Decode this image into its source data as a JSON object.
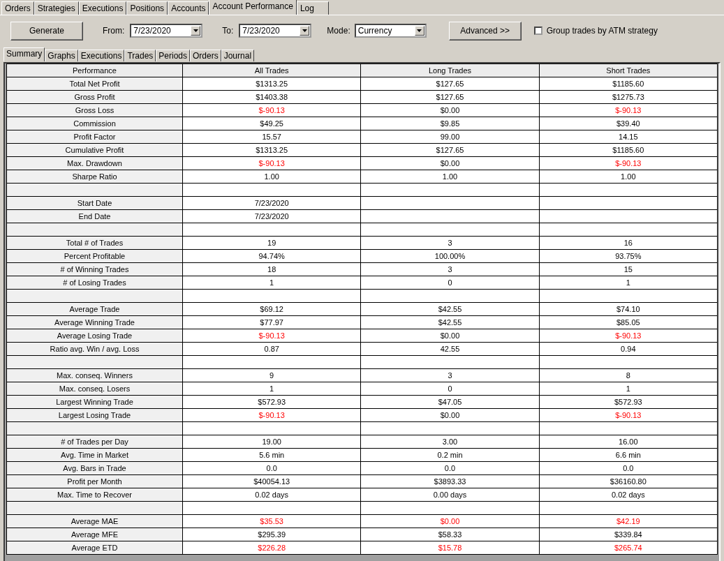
{
  "main_tabs": [
    {
      "label": "Orders",
      "selected": false
    },
    {
      "label": "Strategies",
      "selected": false
    },
    {
      "label": "Executions",
      "selected": false
    },
    {
      "label": "Positions",
      "selected": false
    },
    {
      "label": "Accounts",
      "selected": false
    },
    {
      "label": "Account Performance",
      "selected": true
    },
    {
      "label": "Log",
      "selected": false
    }
  ],
  "toolbar": {
    "generate": "Generate",
    "from_label": "From:",
    "from_value": "7/23/2020",
    "to_label": "To:",
    "to_value": "7/23/2020",
    "mode_label": "Mode:",
    "mode_value": "Currency",
    "advanced": "Advanced >>",
    "group_checkbox": {
      "label": "Group trades by ATM strategy",
      "checked": false
    }
  },
  "sub_tabs": [
    {
      "label": "Summary",
      "selected": true
    },
    {
      "label": "Graphs",
      "selected": false
    },
    {
      "label": "Executions",
      "selected": false
    },
    {
      "label": "Trades",
      "selected": false
    },
    {
      "label": "Periods",
      "selected": false
    },
    {
      "label": "Orders",
      "selected": false
    },
    {
      "label": "Journal",
      "selected": false
    }
  ],
  "table": {
    "columns": [
      "Performance",
      "All Trades",
      "Long Trades",
      "Short Trades"
    ],
    "rows": [
      {
        "kind": "data",
        "label": "Total Net Profit",
        "cells": [
          {
            "text": "$1313.25",
            "negative": false
          },
          {
            "text": "$127.65",
            "negative": false
          },
          {
            "text": "$1185.60",
            "negative": false
          }
        ]
      },
      {
        "kind": "data",
        "label": "Gross Profit",
        "cells": [
          {
            "text": "$1403.38",
            "negative": false
          },
          {
            "text": "$127.65",
            "negative": false
          },
          {
            "text": "$1275.73",
            "negative": false
          }
        ]
      },
      {
        "kind": "data",
        "label": "Gross Loss",
        "cells": [
          {
            "text": "$-90.13",
            "negative": true
          },
          {
            "text": "$0.00",
            "negative": false
          },
          {
            "text": "$-90.13",
            "negative": true
          }
        ]
      },
      {
        "kind": "data",
        "label": "Commission",
        "cells": [
          {
            "text": "$49.25",
            "negative": false
          },
          {
            "text": "$9.85",
            "negative": false
          },
          {
            "text": "$39.40",
            "negative": false
          }
        ]
      },
      {
        "kind": "data",
        "label": "Profit Factor",
        "cells": [
          {
            "text": "15.57",
            "negative": false
          },
          {
            "text": "99.00",
            "negative": false
          },
          {
            "text": "14.15",
            "negative": false
          }
        ]
      },
      {
        "kind": "data",
        "label": "Cumulative Profit",
        "cells": [
          {
            "text": "$1313.25",
            "negative": false
          },
          {
            "text": "$127.65",
            "negative": false
          },
          {
            "text": "$1185.60",
            "negative": false
          }
        ]
      },
      {
        "kind": "data",
        "label": "Max. Drawdown",
        "cells": [
          {
            "text": "$-90.13",
            "negative": true
          },
          {
            "text": "$0.00",
            "negative": false
          },
          {
            "text": "$-90.13",
            "negative": true
          }
        ]
      },
      {
        "kind": "data",
        "label": "Sharpe Ratio",
        "cells": [
          {
            "text": "1.00",
            "negative": false
          },
          {
            "text": "1.00",
            "negative": false
          },
          {
            "text": "1.00",
            "negative": false
          }
        ]
      },
      {
        "kind": "blank"
      },
      {
        "kind": "data",
        "label": "Start Date",
        "cells": [
          {
            "text": "7/23/2020",
            "negative": false
          }
        ]
      },
      {
        "kind": "data",
        "label": "End Date",
        "cells": [
          {
            "text": "7/23/2020",
            "negative": false
          }
        ]
      },
      {
        "kind": "blank"
      },
      {
        "kind": "data",
        "label": "Total # of Trades",
        "cells": [
          {
            "text": "19",
            "negative": false
          },
          {
            "text": "3",
            "negative": false
          },
          {
            "text": "16",
            "negative": false
          }
        ]
      },
      {
        "kind": "data",
        "label": "Percent Profitable",
        "cells": [
          {
            "text": "94.74%",
            "negative": false
          },
          {
            "text": "100.00%",
            "negative": false
          },
          {
            "text": "93.75%",
            "negative": false
          }
        ]
      },
      {
        "kind": "data",
        "label": "# of Winning Trades",
        "cells": [
          {
            "text": "18",
            "negative": false
          },
          {
            "text": "3",
            "negative": false
          },
          {
            "text": "15",
            "negative": false
          }
        ]
      },
      {
        "kind": "data",
        "label": "# of Losing Trades",
        "cells": [
          {
            "text": "1",
            "negative": false
          },
          {
            "text": "0",
            "negative": false
          },
          {
            "text": "1",
            "negative": false
          }
        ]
      },
      {
        "kind": "blank"
      },
      {
        "kind": "data",
        "label": "Average Trade",
        "cells": [
          {
            "text": "$69.12",
            "negative": false
          },
          {
            "text": "$42.55",
            "negative": false
          },
          {
            "text": "$74.10",
            "negative": false
          }
        ]
      },
      {
        "kind": "data",
        "label": "Average Winning Trade",
        "cells": [
          {
            "text": "$77.97",
            "negative": false
          },
          {
            "text": "$42.55",
            "negative": false
          },
          {
            "text": "$85.05",
            "negative": false
          }
        ]
      },
      {
        "kind": "data",
        "label": "Average Losing Trade",
        "cells": [
          {
            "text": "$-90.13",
            "negative": true
          },
          {
            "text": "$0.00",
            "negative": false
          },
          {
            "text": "$-90.13",
            "negative": true
          }
        ]
      },
      {
        "kind": "data",
        "label": "Ratio avg. Win / avg. Loss",
        "cells": [
          {
            "text": "0.87",
            "negative": false
          },
          {
            "text": "42.55",
            "negative": false
          },
          {
            "text": "0.94",
            "negative": false
          }
        ]
      },
      {
        "kind": "blank"
      },
      {
        "kind": "data",
        "label": "Max. conseq. Winners",
        "cells": [
          {
            "text": "9",
            "negative": false
          },
          {
            "text": "3",
            "negative": false
          },
          {
            "text": "8",
            "negative": false
          }
        ]
      },
      {
        "kind": "data",
        "label": "Max. conseq. Losers",
        "cells": [
          {
            "text": "1",
            "negative": false
          },
          {
            "text": "0",
            "negative": false
          },
          {
            "text": "1",
            "negative": false
          }
        ]
      },
      {
        "kind": "data",
        "label": "Largest Winning Trade",
        "cells": [
          {
            "text": "$572.93",
            "negative": false
          },
          {
            "text": "$47.05",
            "negative": false
          },
          {
            "text": "$572.93",
            "negative": false
          }
        ]
      },
      {
        "kind": "data",
        "label": "Largest Losing Trade",
        "cells": [
          {
            "text": "$-90.13",
            "negative": true
          },
          {
            "text": "$0.00",
            "negative": false
          },
          {
            "text": "$-90.13",
            "negative": true
          }
        ]
      },
      {
        "kind": "blank"
      },
      {
        "kind": "data",
        "label": "# of Trades per Day",
        "cells": [
          {
            "text": "19.00",
            "negative": false
          },
          {
            "text": "3.00",
            "negative": false
          },
          {
            "text": "16.00",
            "negative": false
          }
        ]
      },
      {
        "kind": "data",
        "label": "Avg. Time in Market",
        "cells": [
          {
            "text": "5.6 min",
            "negative": false
          },
          {
            "text": "0.2 min",
            "negative": false
          },
          {
            "text": "6.6 min",
            "negative": false
          }
        ]
      },
      {
        "kind": "data",
        "label": "Avg. Bars in Trade",
        "cells": [
          {
            "text": "0.0",
            "negative": false
          },
          {
            "text": "0.0",
            "negative": false
          },
          {
            "text": "0.0",
            "negative": false
          }
        ]
      },
      {
        "kind": "data",
        "label": "Profit per Month",
        "cells": [
          {
            "text": "$40054.13",
            "negative": false
          },
          {
            "text": "$3893.33",
            "negative": false
          },
          {
            "text": "$36160.80",
            "negative": false
          }
        ]
      },
      {
        "kind": "data",
        "label": "Max. Time to Recover",
        "cells": [
          {
            "text": "0.02 days",
            "negative": false
          },
          {
            "text": "0.00 days",
            "negative": false
          },
          {
            "text": "0.02 days",
            "negative": false
          }
        ]
      },
      {
        "kind": "blank"
      },
      {
        "kind": "data",
        "label": "Average MAE",
        "cells": [
          {
            "text": "$35.53",
            "negative": true
          },
          {
            "text": "$0.00",
            "negative": true
          },
          {
            "text": "$42.19",
            "negative": true
          }
        ]
      },
      {
        "kind": "data",
        "label": "Average MFE",
        "cells": [
          {
            "text": "$295.39",
            "negative": false
          },
          {
            "text": "$58.33",
            "negative": false
          },
          {
            "text": "$339.84",
            "negative": false
          }
        ]
      },
      {
        "kind": "data",
        "label": "Average ETD",
        "cells": [
          {
            "text": "$226.28",
            "negative": true
          },
          {
            "text": "$15.78",
            "negative": true
          },
          {
            "text": "$265.74",
            "negative": true
          }
        ]
      }
    ]
  }
}
